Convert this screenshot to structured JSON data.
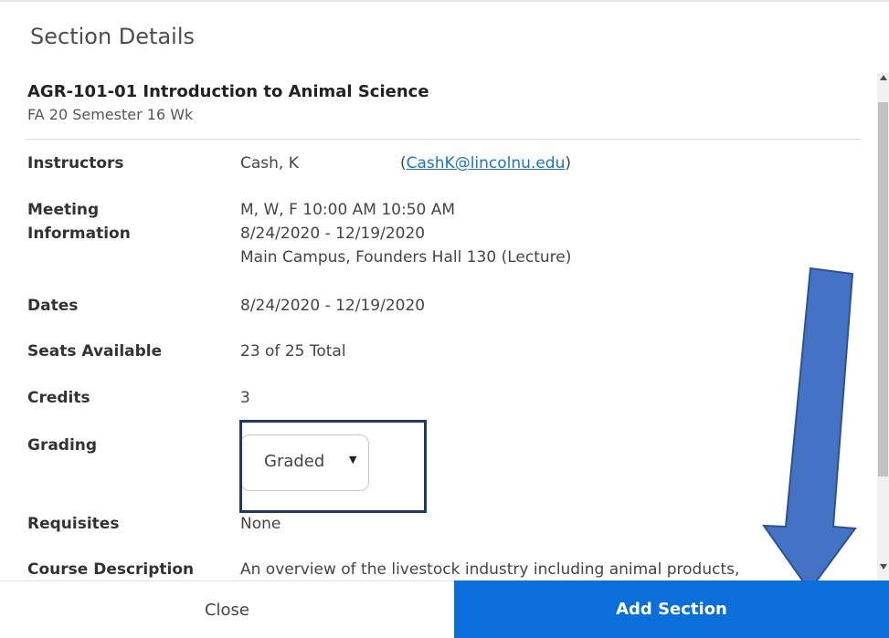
{
  "dialog": {
    "title": "Section Details"
  },
  "section": {
    "title": "AGR-101-01 Introduction to Animal Science",
    "term": "FA 20 Semester 16 Wk"
  },
  "details": {
    "instructors": {
      "label": "Instructors",
      "name": "Cash, K",
      "email_open": "(",
      "email": "CashK@lincolnu.edu",
      "email_close": ")"
    },
    "meeting": {
      "label_line1": "Meeting",
      "label_line2": "Information",
      "line1": "M, W, F 10:00 AM 10:50 AM",
      "line2": "8/24/2020 - 12/19/2020",
      "line3": "Main Campus, Founders Hall 130 (Lecture)"
    },
    "dates": {
      "label": "Dates",
      "value": "8/24/2020 - 12/19/2020"
    },
    "seats": {
      "label": "Seats Available",
      "value": "23 of 25 Total"
    },
    "credits": {
      "label": "Credits",
      "value": "3"
    },
    "grading": {
      "label": "Grading",
      "selected": "Graded"
    },
    "requisites": {
      "label": "Requisites",
      "value": "None"
    },
    "description": {
      "label": "Course Description",
      "value": "An overview of the livestock industry including animal products,"
    }
  },
  "footer": {
    "close_label": "Close",
    "add_label": "Add Section"
  },
  "colors": {
    "primary": "#0a6fd8",
    "annotation_arrow": "#4472c4",
    "annotation_box": "#1f3864"
  },
  "icons": {
    "select_caret": "caret-down-icon",
    "annotation_arrow": "arrow-down-icon"
  }
}
